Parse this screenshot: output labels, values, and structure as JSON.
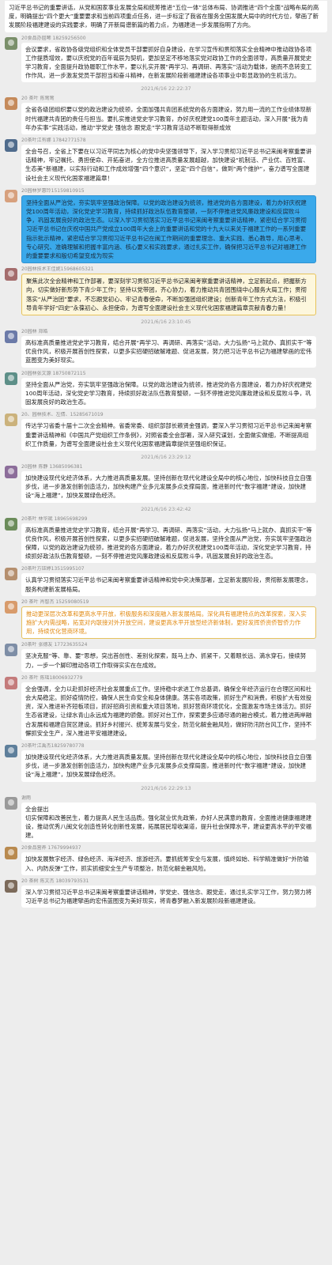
{
  "colors": {
    "page_bg": "#ededed",
    "bubble_bg": "#ffffff",
    "name_text": "#8a8a8a",
    "highlight_blue": "#3aa9eb",
    "highlight_cream": "#fdf7dd",
    "gold_border": "#e7c35a"
  },
  "messages": [
    {
      "name": "",
      "text": "习近平总书记的重要讲话，从党和国家事业发展全局和统筹推进“五位一体”总体布局、协调推进“四个全面”战略布局的高度，明确提出“四个更大”重要要求和当前四项重点任务，进一步标定了我省在服务全国发展大局中的时代方位，擘画了新发展阶段福建建设的实践要求，明确了开新局谱新篇的着力点，为福建进一步发展指明了方向。",
      "style": "first",
      "avatar": "#ffffff"
    },
    {
      "name": "20食品办屈晞 18259256500",
      "text": "会议要求，省政协各级党组织和全体党员干部要抓好自身建设，在学习宣传和贯彻落实全会精神中推动政协各项工作提质增效，要以庆祝党的百年诞辰为契机，更加坚定不移地落实党对政协工作的全面领导，高质量开展党史学习教育，全面提升政协履职工作水平，要以扎实开展“再学习、再调研、再落实”活动为载体，驰而不息转变工作作风，进一步激发党员干部担当和奋斗精神，在新发展阶段新福建建设各项事业中彰显政协的生机活力。",
      "style": "normal",
      "avatar": "#7a8f6a"
    },
    {
      "time": "2021/6/16 22:22:37"
    },
    {
      "name": "20 茶叶  陈莺莺",
      "text": "全省各级团组织要以党的政治建设为统领，全面加强共青团系统党的各方面建设，努力用一流的工作业绩体现新时代福建共青团的责任与担当。要扎实推进党史学习教育，办好庆祝建党100周年主题活动，深入开展“我为青年办实事”实践活动，推动“学党史 强信念 跟党走”学习教育活动不断取得新成效",
      "style": "normal",
      "avatar": "#c58a5a"
    },
    {
      "name": "20茶叶江有娜 17842771578",
      "text": "全会号召，全省上下要在以习近平同志为核心的党中央坚强领导下，深入学习贯彻习近平总书记来闽考察重要讲话精神，牢记嘱托、勇担使命、开拓奋进，全方位推进高质量发展超越，加快建设“机制活、产业优、百姓富、生态美”新福建，以实际行动和工作成效增强“四个意识”，坚定“四个自信”，做到“两个维护”，奋力谱写全面建设社会主义现代化国家福建篇章！",
      "style": "normal",
      "avatar": "#4f6b8c"
    },
    {
      "name": "20园林罗惠玲15159810915",
      "text": "坚持全面从严治党，夯实筑牢坚强政治保障。以党的政治建设为统领，推进党的各方面建设，着力办好庆祝建党100周年活动，深化党史学习教育，持续抓好政治队伍教育整顿，一刻不停推进党风廉政建设和反腐败斗争，巩固发展良好的政治生态。以深入学习贯彻落实习近平总书记来闽考察重要讲话精神，紧密结合学习贯彻习近平总书记在庆祝中国共产党成立100周年大会上的重要讲话和党的十九大以来关于福建工作的一系列重要指示批示精神，紧密结合学习贯彻习近平总书记在闽工作期间的重要理念、重大实践、悉心教导，用心思考、专心研究、准确理解和把握丰富内涵、核心要义和实践要求，通过扎实工作，确保把习近平总书记对福建工作的重要要求和殷切希望变成为现实",
      "style": "blue",
      "avatar": "#d7a07d"
    },
    {
      "name": "20园林技术王佳妮15968605321",
      "text": "聚焦此次全会精神和工作部署，要深刻学习贯彻习近平总书记来闽考察重要讲话精神，立足新起点，把握新方向，切实做好新形势下青少年工作；坚持以党带团，齐心协力，着力推动共青团围绕中心服务大局工作；贯彻落实“从严治团”要求，不忘跟党初心、牢记青春使命，不断加强团组织建设；创新青年工作方式方法，积极引导青年学好“四史”永葆初心、永担使命，为谱写全面建设社会主义现代化国家福建篇章贡献青春力量！",
      "style": "cream",
      "avatar": "#a46c6c"
    },
    {
      "time": "2021/6/16 23:10:45"
    },
    {
      "name": "20园林 郑皓",
      "text": "高标准高质量推进党史学习教育，结合开展“再学习、再调研、再落实”活动，大力弘扬“马上就办、真抓实干”等优良作风，积极开展首创性探索，以更多实招硬招破解难题、促进发展，努力把习近平总书记为福建擘画的宏伟蓝图变为美好现实。",
      "style": "normal",
      "avatar": "#6b7aa8"
    },
    {
      "name": "20园林张文源 18750872115",
      "text": "坚持全面从严治党，夯实筑牢坚强政治保障。以党的政治建设为统领，推进党的各方面建设，着力办好庆祝建党100周年活动，深化党史学习教育，持续抓好政法队伍教育整顿，一刻不停推进党风廉政建设和反腐败斗争，巩固发展良好的政治生态。",
      "style": "normal",
      "avatar": "#5d8f88"
    },
    {
      "name": "20、园林技术、左倩、15285671019",
      "text": "传达学习省委十届十二次全会精神。省委常委、组织部部长赖贤金强调，要深入学习贯彻习近平总书记来闽考察重要讲话精神和《中国共产党组织工作条例》，对照省委全会部署，深入研究谋划，全面做实做细，不断提高组织工作质量，为谱写全面建设社会主义现代化国家福建篇章提供坚强组织保证。",
      "style": "normal",
      "avatar": "#cbb27c"
    },
    {
      "time": "2021/6/16 23:29:12"
    },
    {
      "name": "20园林 陈静 13685096381",
      "text": "加快建设现代化经济体系，大力推进高质量发展。坚持创新在现代化建设全局中的核心地位，加快科技自立自强步伐，进一步激发创新创造活力，加快构建产业多元发展多点支撑局面，推进新时代“数字福建”建设，加快建设“海上福建”，加快发展绿色经济。",
      "style": "normal",
      "avatar": "#8c6d9a"
    },
    {
      "time": "2021/6/16 23:42:42"
    },
    {
      "name": "20茶叶 林华斌 18965698299",
      "text": "高标准高质量推进党史学习教育，结合开展“再学习、再调研、再落实”活动，大力弘扬“马上就办、真抓实干”等优良作风，积极开展首创性探索，以更多实招硬招破解难题，促进发展，坚持全面从严治党，夯实筑牢坚强政治保障，以党的政治建设为统领，推进党的各方面建设，着力办好庆祝建党100周年活动，深化党史学习教育，持续抓好政法队伍教育整顿，一刻不停推进党风廉政建设和反腐败斗争，巩固发展良好的政治生态。",
      "style": "normal",
      "avatar": "#6b8c5a"
    },
    {
      "name": "20茶叶方钰婷13515995107",
      "text": "认真学习贯彻落实习近平总书记来闽考察重要讲话精神和党中央决策部署，立足新发展阶段，贯彻新发展理念，服务构建新发展格局。",
      "style": "normal",
      "avatar": "#b58f6e"
    },
    {
      "name": "20 茶叶 肖智杰 15259080519",
      "text": "推动更深层次改革和更高水平开放，积极服务和深度融入新发展格局。深化具有福建特点的改革探索，深入实施扩大内需战略，拓宽对内联接对外开放空间，建设更高水平开放型经济新体制，更好发挥侨资侨智侨力作用，持续优化营商环境。",
      "style": "framed",
      "avatar": "#d89b6b"
    },
    {
      "name": "20茶叶 张德友 17723635524",
      "text": "坚决克服“等、靠、要”思想，突出首创性、差别化探索，既马上办、抓紧干，又着眼长远、滴水穿石，接续努力，一步一个脚印推动各项工作取得实实在在成效。",
      "style": "normal",
      "avatar": "#7e8ea6"
    },
    {
      "name": "20 茶叶 陈瑶18006932779",
      "text": "全会强调，全力以赴抓好经济社会发展重点工作。坚持稳中求进工作总基调，确保全年经济运行在合理区间和社会大局稳定。抓好疫情防控，确保人民生命安全和身体健康。落实各项政策，抓好生产和消费，积极扩大有效投资，深入推进补齐短板项目，抓好招商引资和重大项目落地，抓好营商环境优化，全面激发市场主体活力。抓好生态省建设，让绿水青山永远成为福建的骄傲。抓好对台工作，探索更多应通尽通的融合模式，着力推进两岸融合发展和福建自贸区建设。抓好乡村振兴、统筹发展与安全，防范化解金融风险，做好防汛防台风工作，坚持不懈抓安全生产，深入推进平安福建建设。",
      "style": "normal",
      "avatar": "#c47b7b"
    },
    {
      "name": "20茶叶江禹杰18259780778",
      "text": "加快建设现代化经济体系，大力推进高质量发展。坚持创新在现代化建设全局中的核心地位，加快科技自立自强步伐，进一步激发创新创造活力，加快构建产业多元发展多点支撑局面，推进新时代“数字福建”建设，加快建设“海上福建”，加快发展绿色经济。",
      "style": "normal",
      "avatar": "#5e7f9b"
    },
    {
      "time": "2021/6/16 22:29:13"
    },
    {
      "name": "谢雨",
      "text": "全会提出\n切实保障和改善民生，着力提高人民生活品质。强化就业优先政策，办好人民满意的教育，全面推进健康福建建设，推动优秀八闽文化创造性转化创新性发展，拓展居民增收渠道，提升社会保障水平，建设更高水平的平安福建。",
      "style": "normal",
      "avatar": "#9a9a9a"
    },
    {
      "name": "20食品营养 17679994937",
      "text": "加快发展数字经济、绿色经济、海洋经济、旅游经济。要抓统筹安全与发展，慎终如始、科学精准做好“外防输入、内防反弹”工作，抓实抓细安全生产专项整治，防范化解金融风险。",
      "style": "normal",
      "avatar": "#b98a4f"
    },
    {
      "name": "20 茶树 陈文杰 18039793531",
      "text": "深入学习贯彻习近平总书记来闽考察重要讲话精神，学党史、强信念、跟党走，通过扎实学习工作，努力努力将习近平总书记为福建擘画的宏伟蓝图变为美好现实，将青春梦融入新发展阶段新福建建设。",
      "style": "normal",
      "avatar": "#7c6a5a"
    }
  ]
}
